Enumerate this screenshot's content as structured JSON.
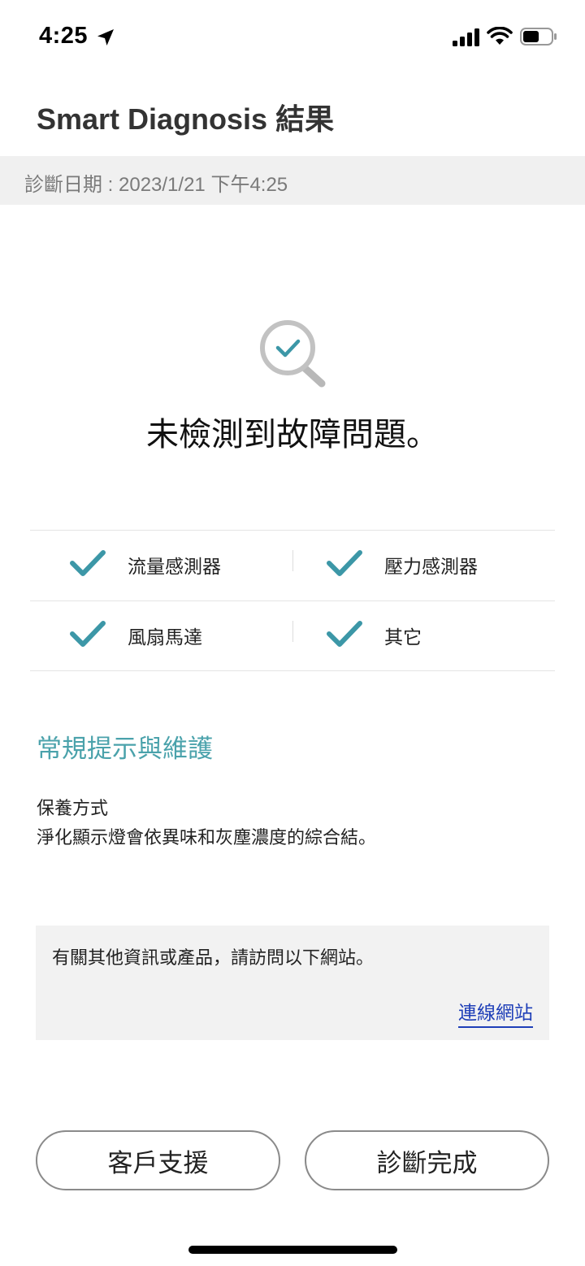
{
  "status_bar": {
    "time": "4:25",
    "icons": [
      "location-arrow-icon",
      "signal-icon",
      "wifi-icon",
      "battery-icon"
    ]
  },
  "header": {
    "title": "Smart Diagnosis 結果"
  },
  "diagnosis_date": "診斷日期 : 2023/1/21 下午4:25",
  "result": {
    "icon": "magnifier-check-icon",
    "title": "未檢測到故障問題。"
  },
  "checklist": {
    "items": [
      {
        "label": "流量感測器",
        "status": "ok"
      },
      {
        "label": "壓力感測器",
        "status": "ok"
      },
      {
        "label": "風扇馬達",
        "status": "ok"
      },
      {
        "label": "其它",
        "status": "ok"
      }
    ]
  },
  "tips": {
    "title": "常規提示與維護",
    "subtitle": "保養方式",
    "body": "淨化顯示燈會依異味和灰塵濃度的綜合結。"
  },
  "info_box": {
    "text": "有關其他資訊或產品，請訪問以下網站。",
    "link_label": "連線網站"
  },
  "buttons": {
    "support_label": "客戶支援",
    "done_label": "診斷完成"
  },
  "colors": {
    "accent_teal": "#4aa2ab",
    "check_teal": "#3c97a7",
    "link_blue": "#1f3fb8",
    "date_bar_bg": "#f0f0f0"
  }
}
